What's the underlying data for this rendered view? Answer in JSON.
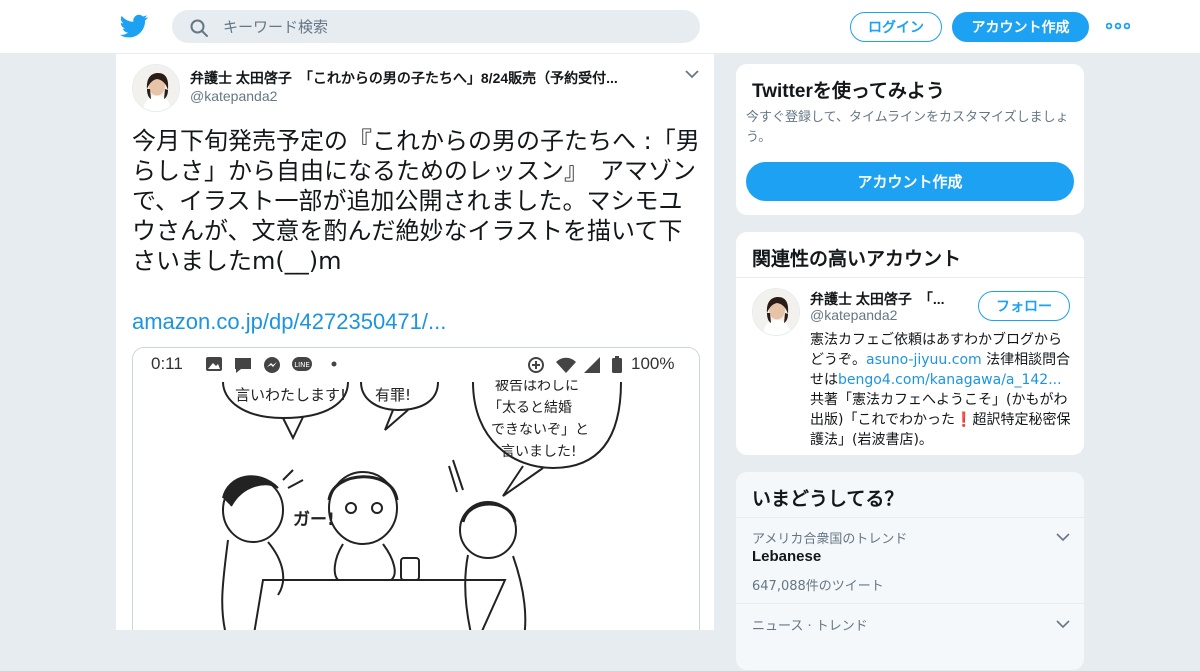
{
  "header": {
    "search_placeholder": "キーワード検索",
    "login_label": "ログイン",
    "signup_label": "アカウント作成"
  },
  "tweet": {
    "author_name": "弁護士 太田啓子　「これからの男の子たちへ」8/24販売（予約受付...",
    "author_handle": "@katepanda2",
    "text": "今月下旬発売予定の『これからの男の子たちへ :「男らしさ」から自由になるためのレッスン』　アマゾンで、イラスト一部が追加公開されました。マシモユウさんが、文意を酌んだ絶妙なイラストを描いて下さいましたm(__)m",
    "link": "amazon.co.jp/dp/4272350471/...",
    "media": {
      "status_time": "0:11",
      "status_battery": "100%",
      "bubble_left": "言いわたします!",
      "bubble_mid": "有罪!",
      "bubble_right_1": "被告はわしに",
      "bubble_right_2": "「太ると結婚",
      "bubble_right_3": "できないぞ」と",
      "bubble_right_4": "言いました!",
      "sfx": "ガー!"
    }
  },
  "try_card": {
    "title": "Twitterを使ってみよう",
    "subtitle": "今すぐ登録して、タイムラインをカスタマイズしましょう。",
    "button": "アカウント作成"
  },
  "related_card": {
    "title": "関連性の高いアカウント",
    "name": "弁護士 太田啓子　「...",
    "handle": "@katepanda2",
    "follow_label": "フォロー",
    "bio_1": "憲法カフェご依頼はあすわかブログからどうぞ。",
    "bio_link_1": "asuno-jiyuu.com",
    "bio_2": " 法律相談問合せは",
    "bio_link_2": "bengo4.com/kanagawa/a_142...",
    "bio_3": " 共著「憲法カフェへようこそ」(かもがわ出版)「これでわかった",
    "bio_mark": "❗",
    "bio_4": "超訳特定秘密保護法」(岩波書店)。"
  },
  "trends_card": {
    "title": "いまどうしてる？",
    "items": [
      {
        "meta": "アメリカ合衆国のトレンド",
        "name": "Lebanese",
        "count": "647,088件のツイート"
      },
      {
        "meta": "ニュース · トレンド",
        "name": "",
        "count": ""
      }
    ]
  },
  "colors": {
    "brand": "#1da1f2",
    "link": "#1b95e0",
    "background": "#e6ecf0"
  }
}
